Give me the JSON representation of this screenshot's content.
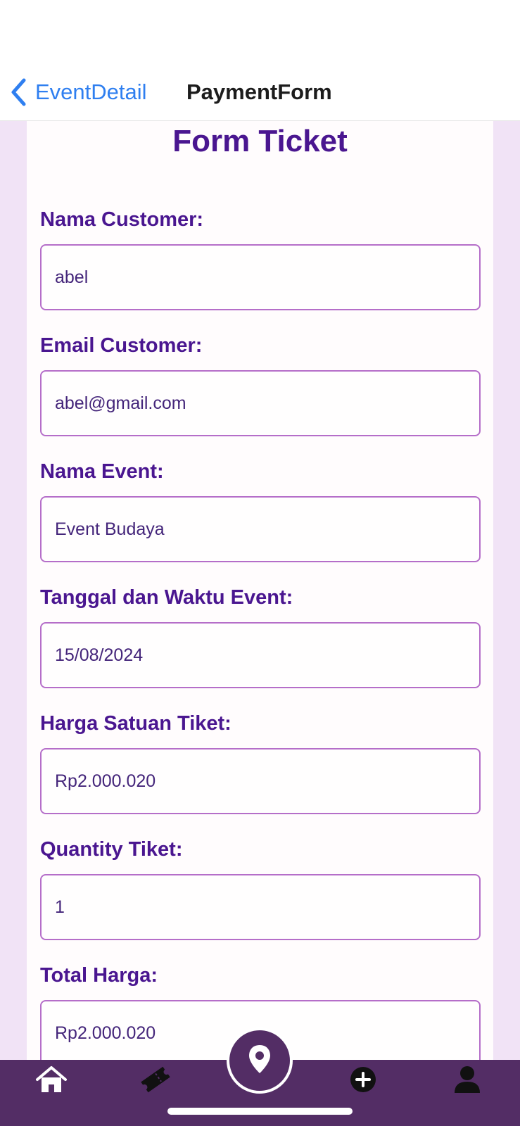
{
  "nav": {
    "back_label": "EventDetail",
    "title": "PaymentForm"
  },
  "form": {
    "title": "Form Ticket",
    "fields": [
      {
        "label": "Nama Customer:",
        "value": "abel"
      },
      {
        "label": "Email Customer:",
        "value": "abel@gmail.com"
      },
      {
        "label": "Nama Event:",
        "value": "Event Budaya"
      },
      {
        "label": "Tanggal dan Waktu Event:",
        "value": "15/08/2024"
      },
      {
        "label": "Harga Satuan Tiket:",
        "value": "Rp2.000.020"
      },
      {
        "label": "Quantity Tiket:",
        "value": "1"
      },
      {
        "label": "Total Harga:",
        "value": "Rp2.000.020"
      }
    ]
  },
  "tab_bar": {
    "items": [
      {
        "icon": "home-icon"
      },
      {
        "icon": "ticket-icon"
      },
      {
        "icon": "location-pin-icon"
      },
      {
        "icon": "add-circle-icon"
      },
      {
        "icon": "user-icon"
      }
    ]
  },
  "colors": {
    "accent_purple": "#4a1690",
    "tab_bar": "#532d65",
    "link_blue": "#2f7ff0",
    "input_border": "#b56ec9",
    "background": "#f1e3f6"
  }
}
